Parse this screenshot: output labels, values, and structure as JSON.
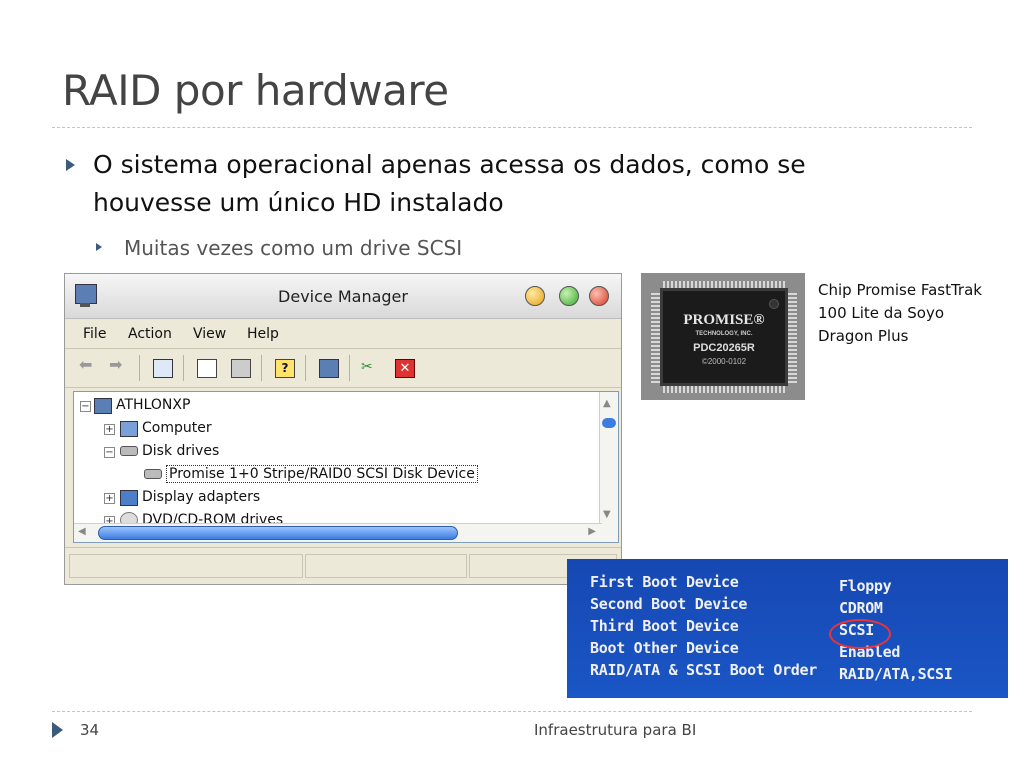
{
  "slide": {
    "title": "RAID por hardware",
    "bullet_1": "O sistema operacional apenas acessa os dados, como se houvesse um único HD instalado",
    "bullet_2": "Muitas vezes como um drive SCSI",
    "page_number": "34",
    "footer": "Infraestrutura para BI"
  },
  "device_manager": {
    "window_title": "Device Manager",
    "menu": [
      "File",
      "Action",
      "View",
      "Help"
    ],
    "tree": [
      {
        "label": "ATHLONXP",
        "expander": "−"
      },
      {
        "label": "Computer",
        "expander": "+"
      },
      {
        "label": "Disk drives",
        "expander": "−"
      },
      {
        "label": "Promise 1+0 Stripe/RAID0 SCSI Disk Device",
        "expander": ""
      },
      {
        "label": "Display adapters",
        "expander": "+"
      },
      {
        "label": "DVD/CD-ROM drives",
        "expander": "+"
      }
    ]
  },
  "chip": {
    "brand": "PROMISE®",
    "subtitle": "TECHNOLOGY, INC.",
    "model": "PDC20265R",
    "code": "©2000-0102",
    "caption": "Chip Promise FastTrak 100 Lite da Soyo Dragon Plus"
  },
  "bios": {
    "rows": [
      {
        "label": "First Boot Device",
        "value": "Floppy"
      },
      {
        "label": "Second Boot Device",
        "value": "CDROM"
      },
      {
        "label": "Third Boot Device",
        "value": "SCSI"
      },
      {
        "label": "Boot Other Device",
        "value": "Enabled"
      },
      {
        "label": "RAID/ATA & SCSI Boot Order",
        "value": "RAID/ATA,SCSI"
      }
    ],
    "highlight_color": "#ee3333"
  },
  "colors": {
    "bullet_arrow": "#3c5a7a",
    "bios_background": "#1a50bd"
  }
}
